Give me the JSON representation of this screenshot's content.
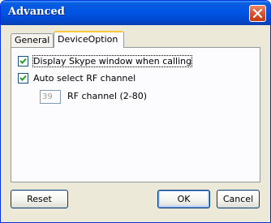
{
  "window": {
    "title": "Advanced"
  },
  "tabs": [
    {
      "label": "General",
      "active": false
    },
    {
      "label": "DeviceOption",
      "active": true
    }
  ],
  "options": {
    "display_skype": {
      "label": "Display Skype window when calling",
      "checked": true
    },
    "auto_select_rf": {
      "label": "Auto select RF channel",
      "checked": true
    },
    "rf_channel": {
      "value": "39",
      "label": "RF channel (2-80)",
      "enabled": false
    }
  },
  "buttons": {
    "reset": "Reset",
    "ok": "OK",
    "cancel": "Cancel"
  },
  "colors": {
    "titlebar": "#0055e5",
    "close": "#d9532c",
    "tab_highlight": "#ffc83c",
    "face": "#ece9d8"
  },
  "icons": {
    "close": "close-icon",
    "check": "checkmark-icon"
  }
}
